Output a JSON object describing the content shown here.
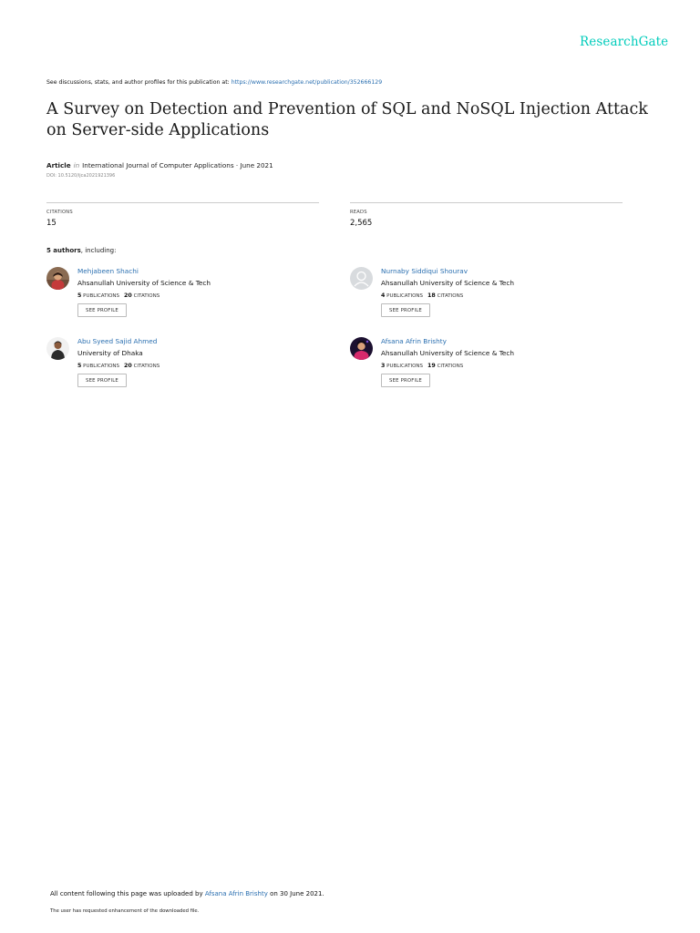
{
  "brand": {
    "name": "ResearchGate",
    "color": "#00ccbb"
  },
  "discuss": {
    "prefix": "See discussions, stats, and author profiles for this publication at:",
    "url": "https://www.researchgate.net/publication/352666129"
  },
  "publication": {
    "title": "A Survey on Detection and Prevention of SQL and NoSQL Injection Attack on Server-side Applications",
    "type": "Article",
    "in_word": "in",
    "venue_date": "International Journal of Computer Applications · June 2021",
    "doi": "DOI: 10.5120/ijca2021921396"
  },
  "stats": {
    "citations_label": "CITATIONS",
    "citations_value": "15",
    "reads_label": "READS",
    "reads_value": "2,565"
  },
  "authors_header": {
    "count": "5 authors",
    "suffix": ", including:"
  },
  "authors": [
    {
      "name": "Mehjabeen Shachi",
      "institution": "Ahsanullah University of Science & Tech",
      "publications": "5",
      "publications_label": "PUBLICATIONS",
      "citations": "20",
      "citations_label": "CITATIONS",
      "button": "SEE PROFILE"
    },
    {
      "name": "Nurnaby Siddiqui Shourav",
      "institution": "Ahsanullah University of Science & Tech",
      "publications": "4",
      "publications_label": "PUBLICATIONS",
      "citations": "18",
      "citations_label": "CITATIONS",
      "button": "SEE PROFILE"
    },
    {
      "name": "Abu Syeed Sajid Ahmed",
      "institution": "University of Dhaka",
      "publications": "5",
      "publications_label": "PUBLICATIONS",
      "citations": "20",
      "citations_label": "CITATIONS",
      "button": "SEE PROFILE"
    },
    {
      "name": "Afsana Afrin Brishty",
      "institution": "Ahsanullah University of Science & Tech",
      "publications": "3",
      "publications_label": "PUBLICATIONS",
      "citations": "19",
      "citations_label": "CITATIONS",
      "button": "SEE PROFILE"
    }
  ],
  "footer": {
    "line1_prefix": "All content following this page was uploaded by",
    "uploader": "Afsana Afrin Brishty",
    "line1_suffix": "on 30 June 2021.",
    "line2": "The user has requested enhancement of the downloaded file."
  }
}
